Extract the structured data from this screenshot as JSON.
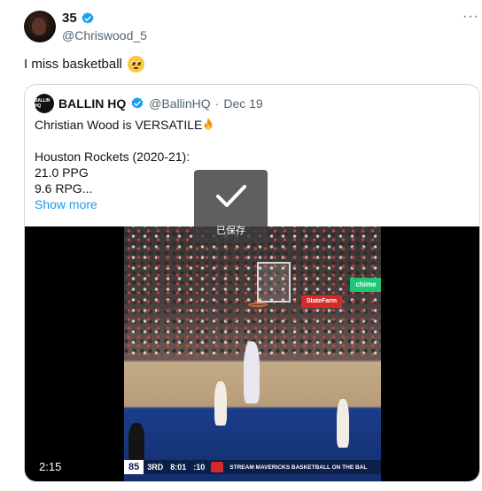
{
  "tweet": {
    "display_name": "35",
    "handle": "@Chriswood_5",
    "more_label": "···",
    "text": "I miss basketball",
    "emoji": "pleading-face-emoji"
  },
  "quote": {
    "avatar_text": "BALLIN HQ",
    "display_name": "BALLIN HQ",
    "handle": "@BallinHQ",
    "separator": "·",
    "date": "Dec 19",
    "lines": [
      "Christian Wood is VERSATILE",
      "",
      "Houston Rockets (2020-21):",
      "21.0 PPG",
      "9.6 RPG..."
    ],
    "show_more": "Show more"
  },
  "video": {
    "duration": "2:15",
    "scoreboard": {
      "score": "85",
      "quarter": "3RD",
      "clock": "8:01",
      "shot_clock": ":10",
      "stream_text": "STREAM MAVERICKS BASKETBALL ON THE BAL"
    },
    "signage": {
      "statefarm": "StateFarm",
      "chime": "chime"
    }
  },
  "overlay": {
    "saved_label": "已保存"
  },
  "colors": {
    "link": "#1d9bf0",
    "verified": "#1d9bf0",
    "secondary_text": "#536471"
  }
}
